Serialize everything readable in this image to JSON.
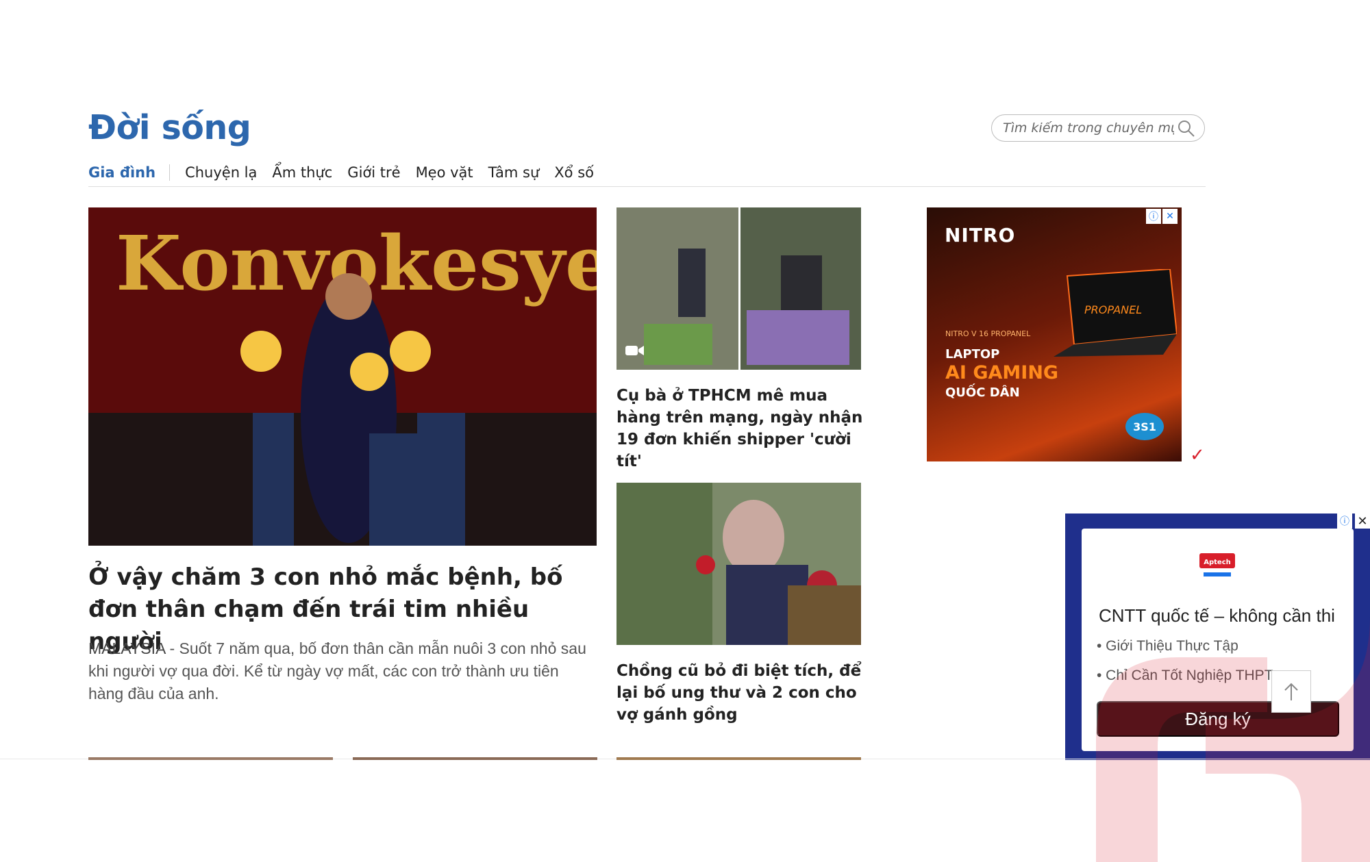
{
  "section": {
    "title": "Đời sống"
  },
  "search": {
    "placeholder": "Tìm kiếm trong chuyên mục"
  },
  "subnav": {
    "items": [
      "Gia đình",
      "Chuyện lạ",
      "Ẩm thực",
      "Giới trẻ",
      "Mẹo vặt",
      "Tâm sự",
      "Xổ số"
    ],
    "active_index": 0
  },
  "lead": {
    "title": "Ở vậy chăm 3 con nhỏ mắc bệnh, bố đơn thân chạm đến trái tim nhiều người",
    "location": "MALAYSIA",
    "sapo": " - Suốt 7 năm qua, bố đơn thân cần mẫn nuôi 3 con nhỏ sau khi người vợ qua đời. Kể từ ngày vợ mất, các con trở thành ưu tiên hàng đầu của anh.",
    "image_text": "Konvokesyen"
  },
  "cards": [
    {
      "title": "Cụ bà ở TPHCM mê mua hàng trên mạng, ngày nhận 19 đơn khiến shipper 'cười tít'",
      "has_video": true
    },
    {
      "title": "Chồng cũ bỏ đi biệt tích, để lại bố ung thư và 2 con cho vợ gánh gồng",
      "has_video": false
    }
  ],
  "ad_right": {
    "brand": "NITRO",
    "model": "NITRO V 16 PROPANEL",
    "line1": "LAPTOP",
    "line2": "AI GAMING",
    "line3": "QUỐC DÂN",
    "screen_text": "PROPANEL",
    "badge": "3S1"
  },
  "popup_ad": {
    "headline": "CNTT quốc tế – không cần thi",
    "bullet1": "• Giới Thiệu Thực Tập",
    "bullet2": "• Chỉ Cần Tốt Nghiệp THPT",
    "cta": "Đăng ký",
    "logo_text": "Aptech"
  },
  "icons": {
    "search": "search-icon",
    "video": "video-camera-icon",
    "adchoices": "adchoices-icon",
    "close": "close-icon",
    "scroll_top": "arrow-up-icon"
  },
  "colors": {
    "brand_blue": "#2d67ad",
    "text": "#222222",
    "sapo": "#555555",
    "popup_bg": "#1f2f8c",
    "cta_bg": "#3b1216",
    "ad_accent": "#ff8a1c"
  }
}
